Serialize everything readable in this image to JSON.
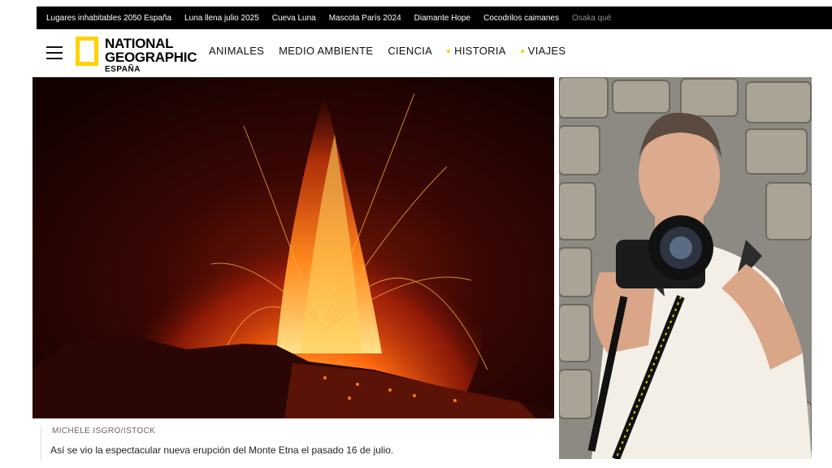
{
  "trending": {
    "items": [
      "Lugares inhabitables 2050 España",
      "Luna llena julio 2025",
      "Cueva Luna",
      "Mascota París 2024",
      "Diamante Hope",
      "Cocodrilos caimanes",
      "Osaka qué"
    ]
  },
  "header": {
    "logo": {
      "line1": "NATIONAL",
      "line2": "GEOGRAPHIC",
      "line3": "ESPAÑA"
    },
    "nav": [
      "ANIMALES",
      "MEDIO AMBIENTE",
      "CIENCIA",
      "HISTORIA",
      "VIAJES"
    ]
  },
  "hero": {
    "credit": "MICHELE ISGRO/ISTOCK",
    "caption": "Así se vio la espectacular nueva erupción del Monte Etna el pasado 16 de julio."
  },
  "colors": {
    "brand_yellow": "#FFD200",
    "topbar": "#000000"
  },
  "icons": {
    "menu": "hamburger-icon"
  }
}
